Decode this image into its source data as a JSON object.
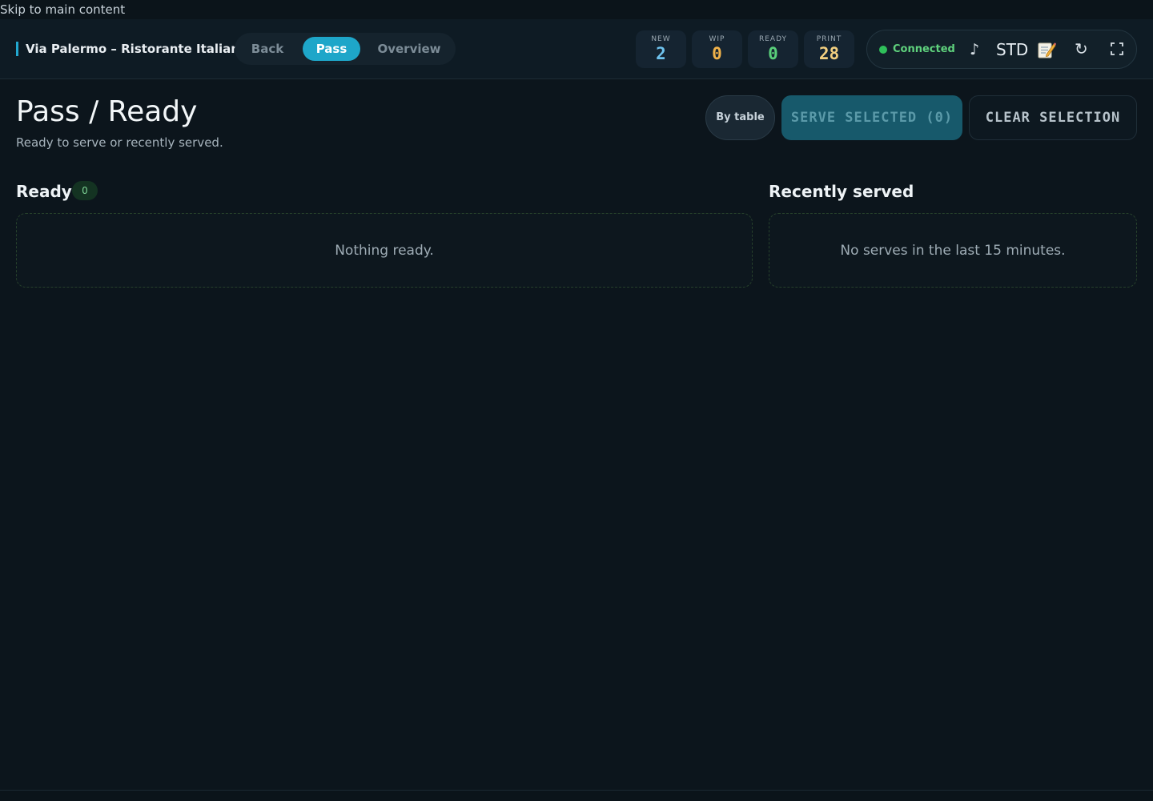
{
  "skip_link": "Skip to main content",
  "header": {
    "brand": "Via Palermo – Ristorante Italiano",
    "nav": [
      {
        "label": "Back",
        "active": false
      },
      {
        "label": "Pass",
        "active": true
      },
      {
        "label": "Overview",
        "active": false
      }
    ],
    "stats": [
      {
        "label": "NEW",
        "value": "2",
        "color": "#6fc3ee"
      },
      {
        "label": "WIP",
        "value": "0",
        "color": "#f0b24a"
      },
      {
        "label": "READY",
        "value": "0",
        "color": "#59cf7a"
      },
      {
        "label": "PRINT",
        "value": "28",
        "color": "#f3d080"
      }
    ],
    "connection": {
      "status": "Connected",
      "status_color": "#2fc05a",
      "sound_icon": "♪",
      "mode": "STD",
      "notes_icon": "memo-icon",
      "refresh_icon": "↻",
      "fullscreen_icon": "fullscreen-icon"
    }
  },
  "page": {
    "title": "Pass / Ready",
    "subtitle": "Ready to serve or recently served."
  },
  "actions": {
    "by_table": "By table",
    "serve_selected": "SERVE SELECTED (0)",
    "clear_selection": "CLEAR SELECTION"
  },
  "ready": {
    "title": "Ready",
    "count": "0",
    "empty": "Nothing ready."
  },
  "recent": {
    "title": "Recently served",
    "empty": "No serves in the last 15 minutes."
  },
  "colors": {
    "accent": "#1ea6c9",
    "background": "#0c151c"
  }
}
